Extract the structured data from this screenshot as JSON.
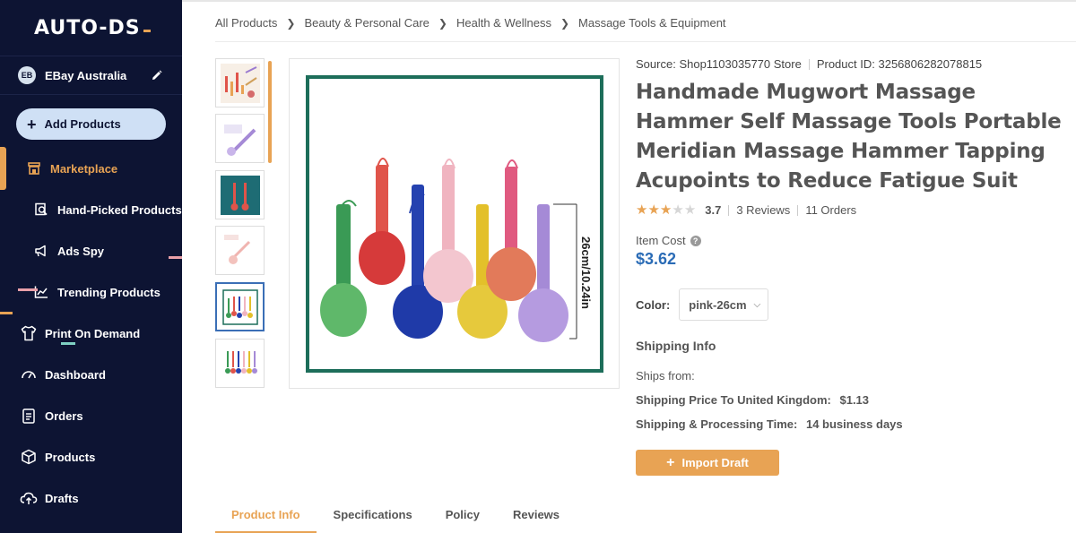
{
  "app": {
    "logo": "AUTO-DS",
    "brand_accent": "#e8a354",
    "sidebar_bg": "#0d1433"
  },
  "account": {
    "initials": "EB",
    "name": "EBay Australia",
    "edit_icon": "pencil-icon"
  },
  "sidebar": {
    "add_products": "Add Products",
    "items": [
      {
        "label": "Marketplace",
        "icon": "store-icon",
        "active": true
      },
      {
        "label": "Hand-Picked Products",
        "icon": "search-doc-icon"
      },
      {
        "label": "Ads Spy",
        "icon": "megaphone-icon"
      },
      {
        "label": "Trending Products",
        "icon": "trend-chart-icon"
      },
      {
        "label": "Print On Demand",
        "icon": "shirt-icon"
      },
      {
        "label": "Dashboard",
        "icon": "gauge-icon"
      },
      {
        "label": "Orders",
        "icon": "clipboard-icon"
      },
      {
        "label": "Products",
        "icon": "box-icon"
      },
      {
        "label": "Drafts",
        "icon": "cloud-upload-icon"
      }
    ]
  },
  "breadcrumb": [
    "All Products",
    "Beauty & Personal Care",
    "Health & Wellness",
    "Massage Tools & Equipment"
  ],
  "product": {
    "source_label": "Source:",
    "source": "Shop1103035770 Store",
    "id_label": "Product ID:",
    "id": "3256806282078815",
    "title": "Handmade Mugwort Massage Hammer Self Massage Tools Portable Meridian Massage Hammer Tapping Acupoints to Reduce Fatigue Suit",
    "rating": "3.7",
    "rating_value": 3.7,
    "reviews": "3 Reviews",
    "orders": "11 Orders",
    "item_cost_label": "Item Cost",
    "price": "$3.62",
    "color_label": "Color:",
    "color_value": "pink-26cm",
    "image_dimension_text": "26cm/10.24in"
  },
  "shipping": {
    "title": "Shipping Info",
    "from_label": "Ships from:",
    "price_label": "Shipping Price To United Kingdom:",
    "price_value": "$1.13",
    "time_label": "Shipping & Processing Time:",
    "time_value": "14 business days"
  },
  "actions": {
    "import_draft": "Import Draft"
  },
  "tabs": [
    "Product Info",
    "Specifications",
    "Policy",
    "Reviews"
  ]
}
